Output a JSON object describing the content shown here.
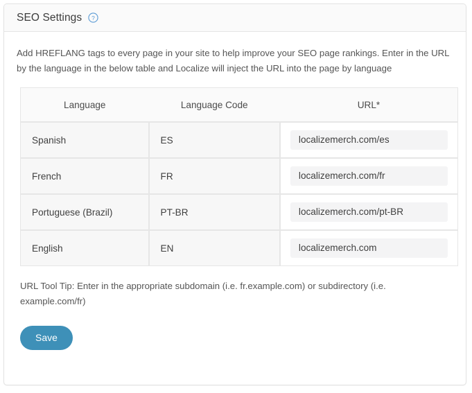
{
  "card": {
    "title": "SEO Settings",
    "help_icon": "help-circle-icon",
    "description": "Add HREFLANG tags to every page in your site to help improve your SEO page rankings. Enter in the URL by the language in the below table and Localize will inject the URL into the page by language",
    "tooltip_note": "URL Tool Tip: Enter in the appropriate subdomain (i.e. fr.example.com) or subdirectory (i.e. example.com/fr)",
    "save_label": "Save",
    "accent_color": "#3e90b8",
    "help_icon_color": "#5b9bd5"
  },
  "table": {
    "columns": [
      "Language",
      "Language Code",
      "URL*"
    ],
    "rows": [
      {
        "language": "Spanish",
        "code": "ES",
        "url": "localizemerch.com/es"
      },
      {
        "language": "French",
        "code": "FR",
        "url": "localizemerch.com/fr"
      },
      {
        "language": "Portuguese (Brazil)",
        "code": "PT-BR",
        "url": "localizemerch.com/pt-BR"
      },
      {
        "language": "English",
        "code": "EN",
        "url": "localizemerch.com"
      }
    ]
  }
}
